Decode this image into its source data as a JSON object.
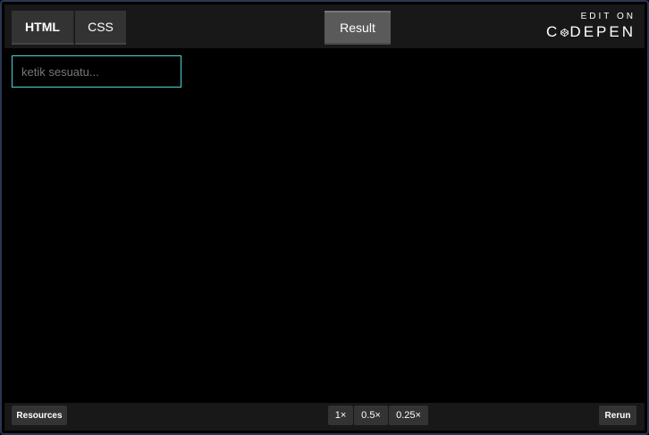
{
  "tabs": {
    "html": "HTML",
    "css": "CSS",
    "result": "Result"
  },
  "codepen": {
    "edit_on": "EDIT ON",
    "brand_left": "C",
    "brand_right": "DEPEN"
  },
  "input": {
    "placeholder": "ketik sesuatu..."
  },
  "bottom": {
    "resources": "Resources",
    "zoom": [
      "1×",
      "0.5×",
      "0.25×"
    ],
    "rerun": "Rerun"
  }
}
